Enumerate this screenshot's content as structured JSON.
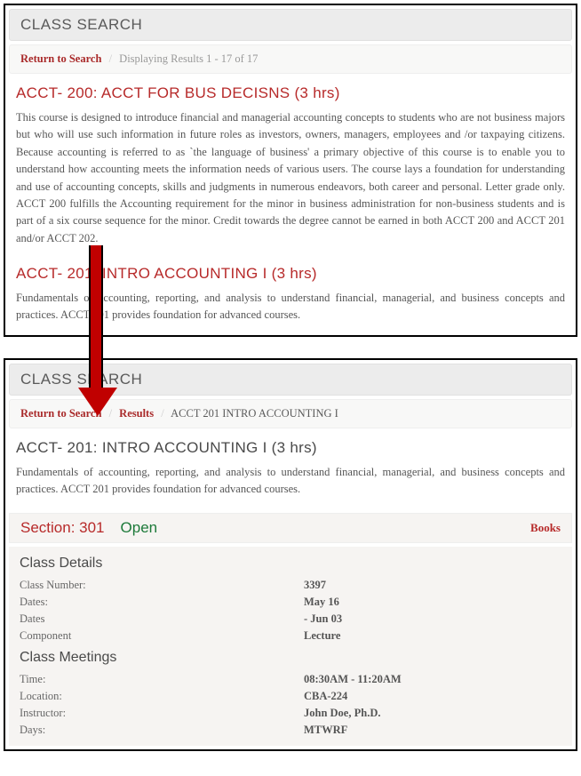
{
  "panel1": {
    "title": "CLASS SEARCH",
    "breadcrumb": {
      "return": "Return to Search",
      "results": "Displaying Results  1 -  17 of  17"
    },
    "course1": {
      "title": "ACCT- 200: ACCT FOR BUS DECISNS (3 hrs)",
      "desc": "This course is designed to introduce financial and managerial accounting concepts to students who are not business majors but who will use such information in future roles as investors, owners, managers, employees and /or taxpaying citizens. Because accounting is referred to as `the language of business' a primary objective of this course is to enable you to understand how accounting meets the information needs of various users. The course lays a foundation for understanding and use of accounting concepts, skills and judgments in numerous endeavors, both career and personal. Letter grade only. ACCT 200 fulfills the Accounting requirement for the minor in business administration for non-business students and is part of a six course sequence for the minor. Credit towards the degree cannot be earned in both ACCT 200 and ACCT 201 and/or ACCT 202."
    },
    "course2": {
      "title": "ACCT- 201: INTRO ACCOUNTING I (3 hrs)",
      "desc": "Fundamentals of accounting, reporting, and analysis to understand financial, managerial, and business concepts and practices. ACCT 201 provides foundation for advanced courses."
    }
  },
  "panel2": {
    "title": "CLASS SEARCH",
    "breadcrumb": {
      "return": "Return to Search",
      "results": "Results",
      "current": "ACCT 201  INTRO ACCOUNTING I"
    },
    "course": {
      "title": "ACCT- 201: INTRO ACCOUNTING I (3 hrs)",
      "desc": "Fundamentals of accounting, reporting, and analysis to understand financial, managerial, and business concepts and practices. ACCT 201 provides foundation for advanced courses."
    },
    "section": {
      "label": "Section: 301",
      "status": "Open",
      "books": "Books"
    },
    "class_details_header": "Class Details",
    "class_details": [
      {
        "label": "Class Number:",
        "value": "3397"
      },
      {
        "label": "Dates:",
        "value": "May 16"
      },
      {
        "label": "Dates",
        "value": " - Jun 03"
      },
      {
        "label": "Component",
        "value": "Lecture"
      }
    ],
    "meetings_header": "Class Meetings",
    "meetings": [
      {
        "label": "Time:",
        "value": "08:30AM - 11:20AM"
      },
      {
        "label": "Location:",
        "value": "CBA-224"
      },
      {
        "label": "Instructor:",
        "value": "John Doe, Ph.D."
      },
      {
        "label": "Days:",
        "value": "MTWRF"
      }
    ]
  }
}
